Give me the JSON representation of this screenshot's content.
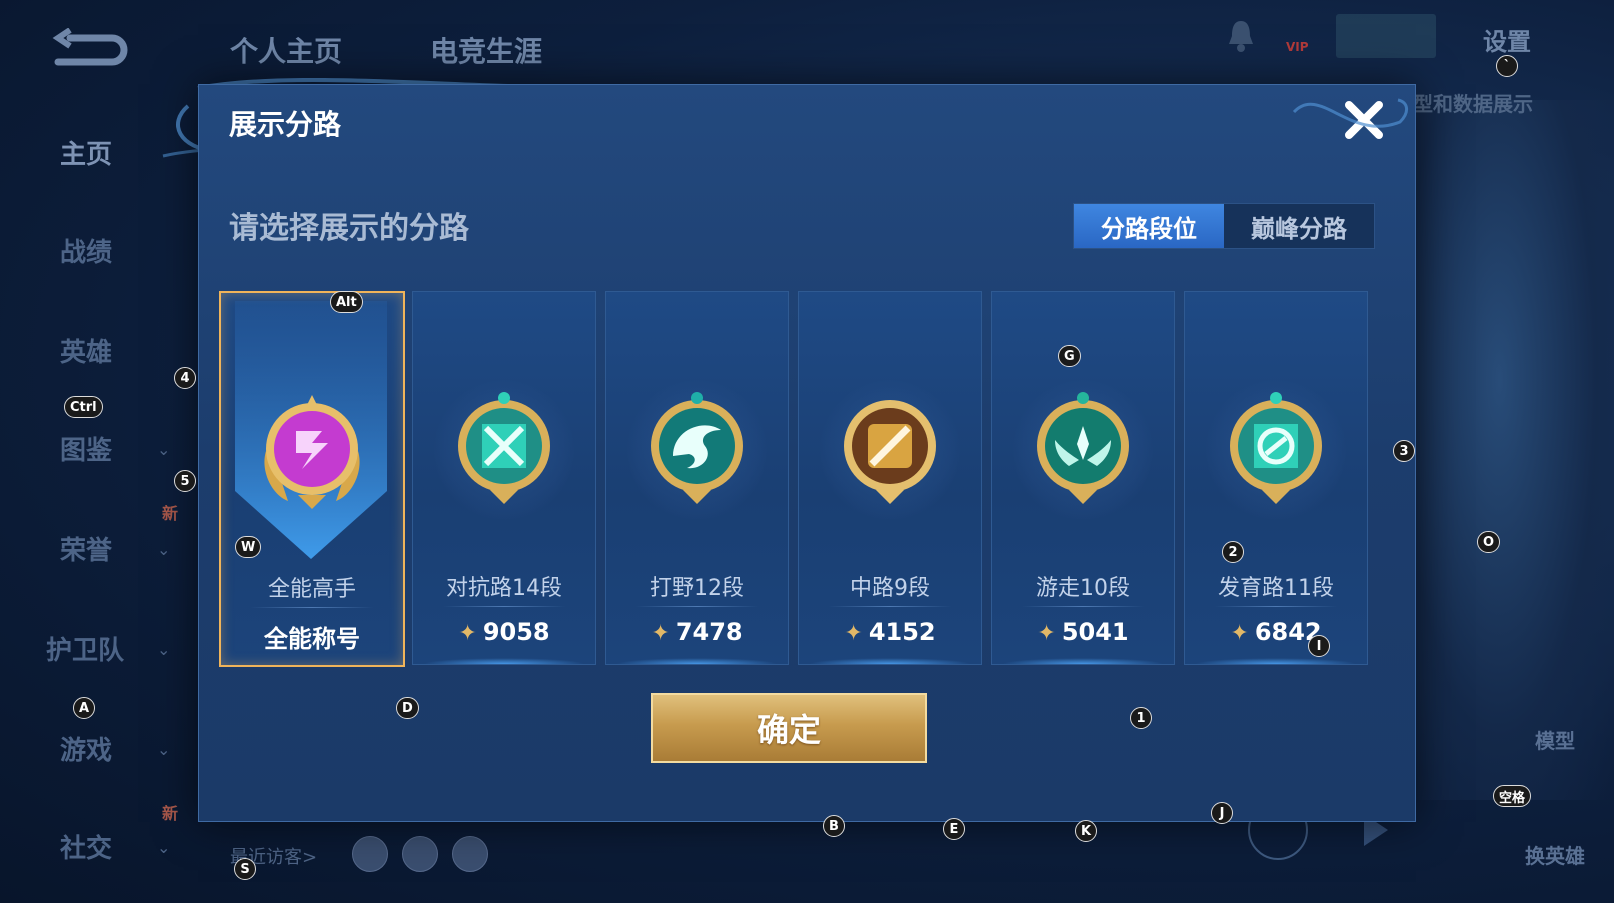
{
  "background": {
    "top_tabs": [
      "个人主页",
      "电竞生涯"
    ],
    "settings": "设置",
    "data_show": "型和数据展示",
    "sidebar": [
      {
        "label": "主页",
        "active": true,
        "chevron": false
      },
      {
        "label": "战绩",
        "active": false,
        "chevron": false
      },
      {
        "label": "英雄",
        "active": false,
        "chevron": false
      },
      {
        "label": "图鉴",
        "active": false,
        "chevron": true
      },
      {
        "label": "荣誉",
        "active": false,
        "chevron": true
      },
      {
        "label": "护卫队",
        "active": false,
        "chevron": true
      },
      {
        "label": "游戏",
        "active": false,
        "chevron": true
      },
      {
        "label": "社交",
        "active": false,
        "chevron": true
      }
    ],
    "new_badge": "新",
    "recent_visitors": "最近访客>",
    "vip": "VIP",
    "model": "模型",
    "switch_hero": "换英雄"
  },
  "modal": {
    "title": "展示分路",
    "prompt": "请选择展示的分路",
    "tabs": [
      {
        "label": "分路段位",
        "active": true
      },
      {
        "label": "巅峰分路",
        "active": false
      }
    ],
    "cards": [
      {
        "name": "全能高手",
        "value": "全能称号",
        "selected": true,
        "badge": "all-round",
        "color": "#c43bd0"
      },
      {
        "name": "对抗路14段",
        "value": "9058",
        "selected": false,
        "badge": "clash-lane",
        "color": "#2fd0b8"
      },
      {
        "name": "打野12段",
        "value": "7478",
        "selected": false,
        "badge": "jungle",
        "color": "#1fb0a8"
      },
      {
        "name": "中路9段",
        "value": "4152",
        "selected": false,
        "badge": "mid-lane",
        "color": "#d9a441"
      },
      {
        "name": "游走10段",
        "value": "5041",
        "selected": false,
        "badge": "roam",
        "color": "#25b59c"
      },
      {
        "name": "发育路11段",
        "value": "6842",
        "selected": false,
        "badge": "farm-lane",
        "color": "#2fd0b8"
      }
    ],
    "confirm": "确定"
  },
  "key_hints": {
    "alt": "Alt",
    "ctrl": "Ctrl",
    "space": "空格",
    "k4": "4",
    "k5": "5",
    "k3": "3",
    "k2": "2",
    "k1": "1",
    "w": "W",
    "g": "G",
    "o": "O",
    "a": "A",
    "d": "D",
    "i": "I",
    "b": "B",
    "e": "E",
    "k": "K",
    "j": "J",
    "s": "S",
    "backtick": "`"
  }
}
